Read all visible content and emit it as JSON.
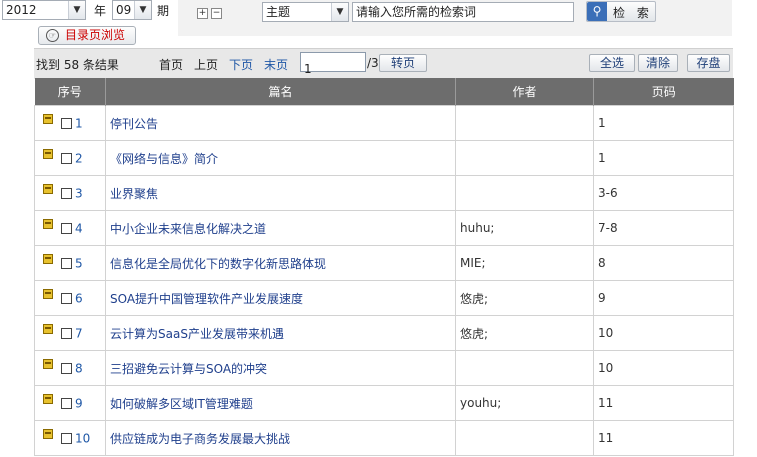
{
  "filters": {
    "year_value": "2012",
    "year_unit": "年",
    "issue_value": "09",
    "issue_unit": "期",
    "expand_symbol": "⊞",
    "collapse_symbol": "⊟",
    "field_value": "主题",
    "search_placeholder": "请输入您所需的检索词",
    "search_label": "检 索",
    "catalog_label": "目录页浏览"
  },
  "pager": {
    "result_text": "找到 58 条结果",
    "first": "首页",
    "prev": "上页",
    "next": "下页",
    "last": "末页",
    "current_page": "1",
    "total": "/3",
    "go": "转页",
    "select_all": "全选",
    "clear": "清除",
    "save": "存盘"
  },
  "table": {
    "headers": [
      "序号",
      "篇名",
      "作者",
      "页码"
    ],
    "rows": [
      {
        "num": "1",
        "title": "停刊公告",
        "author": "",
        "pages": "1"
      },
      {
        "num": "2",
        "title": "《网络与信息》简介",
        "author": "",
        "pages": "1"
      },
      {
        "num": "3",
        "title": "业界聚焦",
        "author": "",
        "pages": "3-6"
      },
      {
        "num": "4",
        "title": "中小企业未来信息化解决之道",
        "author": "huhu;",
        "pages": "7-8"
      },
      {
        "num": "5",
        "title": "信息化是全局优化下的数字化新思路体现",
        "author": "MIE;",
        "pages": "8"
      },
      {
        "num": "6",
        "title": "SOA提升中国管理软件产业发展速度",
        "author": "悠虎;",
        "pages": "9"
      },
      {
        "num": "7",
        "title": "云计算为SaaS产业发展带来机遇",
        "author": "悠虎;",
        "pages": "10"
      },
      {
        "num": "8",
        "title": "三招避免云计算与SOA的冲突",
        "author": "",
        "pages": "10"
      },
      {
        "num": "9",
        "title": "如何破解多区域IT管理难题",
        "author": "youhu;",
        "pages": "11"
      },
      {
        "num": "10",
        "title": "供应链成为电子商务发展最大挑战",
        "author": "",
        "pages": "11"
      }
    ]
  }
}
